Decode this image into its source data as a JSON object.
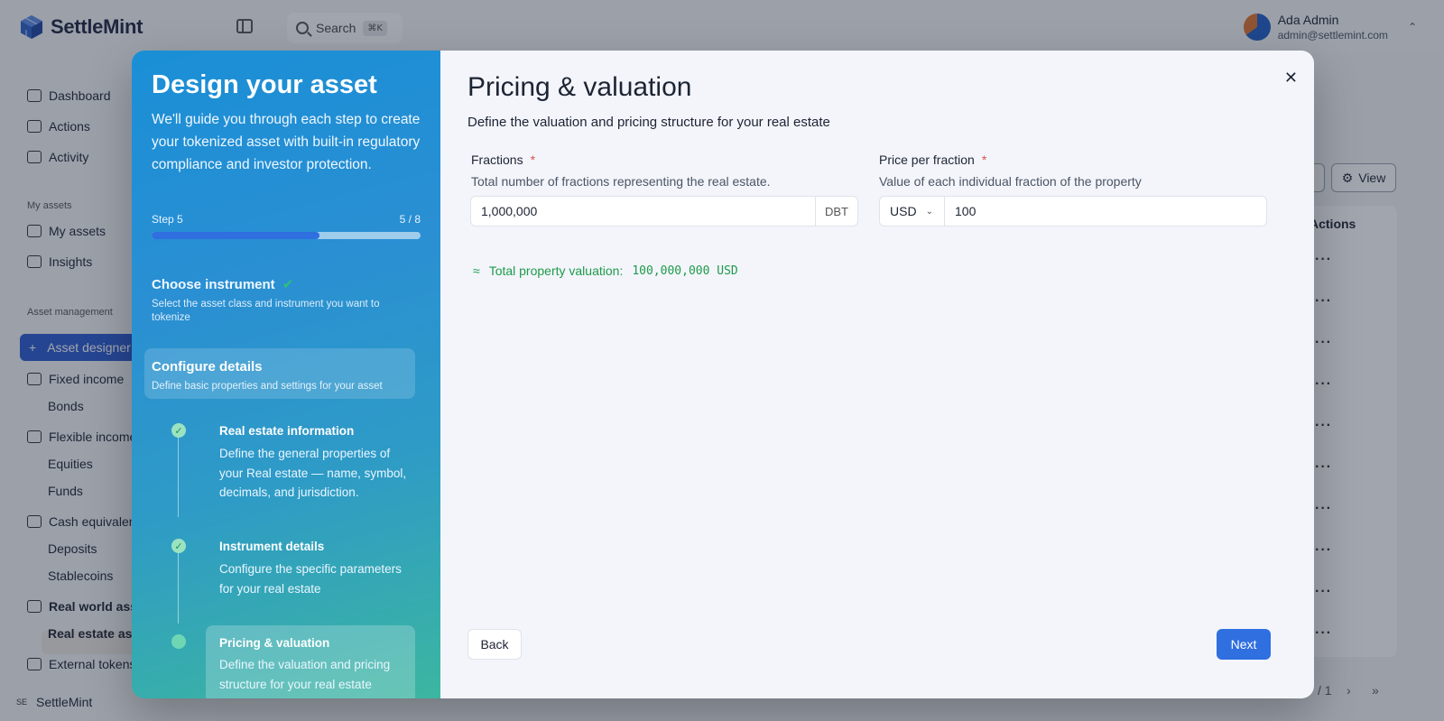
{
  "app": {
    "brand": "SettleMint",
    "search_label": "Search",
    "search_shortcut": "⌘K",
    "user_name": "Ada Admin",
    "user_email": "admin@settlemint.com"
  },
  "sidebar": {
    "items_top": [
      {
        "label": "Dashboard"
      },
      {
        "label": "Actions"
      },
      {
        "label": "Activity"
      }
    ],
    "group_my_assets": "My assets",
    "my_assets": [
      {
        "label": "My assets"
      },
      {
        "label": "Insights"
      }
    ],
    "group_asset_management": "Asset management",
    "asset_designer": "Asset designer",
    "fixed_income": "Fixed income",
    "bonds": "Bonds",
    "flexible_income": "Flexible income",
    "equities": "Equities",
    "funds": "Funds",
    "cash_equivalents": "Cash equivalents",
    "deposits": "Deposits",
    "stablecoins": "Stablecoins",
    "real_world_assets": "Real world assets",
    "real_estate_assets": "Real estate assets",
    "external_tokens": "External tokens",
    "org_badge": "SE",
    "org_name": "SettleMint"
  },
  "background_table": {
    "view_label": "View",
    "actions_header": "Actions",
    "page_info": "/ 1"
  },
  "wizard": {
    "title": "Design your asset",
    "description": "We'll guide you through each step to create your tokenized asset with built-in regulatory compliance and investor protection.",
    "step_label": "Step 5",
    "step_count": "5 / 8",
    "progress_fraction": 0.625,
    "choose_instrument": {
      "title": "Choose instrument",
      "desc": "Select the asset class and instrument you want to tokenize"
    },
    "configure_details": {
      "title": "Configure details",
      "desc": "Define basic properties and settings for your asset"
    },
    "substeps": [
      {
        "title": "Real estate information",
        "desc": "Define the general properties of your Real estate — name, symbol, decimals, and jurisdiction."
      },
      {
        "title": "Instrument details",
        "desc": "Configure the specific parameters for your real estate"
      },
      {
        "title": "Pricing & valuation",
        "desc": "Define the valuation and pricing structure for your real estate"
      }
    ]
  },
  "form": {
    "title": "Pricing & valuation",
    "subtitle": "Define the valuation and pricing structure for your real estate",
    "fractions_label": "Fractions",
    "fractions_help": "Total number of fractions representing the real estate.",
    "fractions_value": "1,000,000",
    "fractions_unit": "DBT",
    "price_label": "Price per fraction",
    "price_help": "Value of each individual fraction of the property",
    "currency": "USD",
    "price_value": "100",
    "required_mark": "*",
    "valuation_symbol": "≈",
    "valuation_label": "Total property valuation:",
    "valuation_value": "100,000,000 USD",
    "back_label": "Back",
    "next_label": "Next",
    "close_symbol": "✕"
  },
  "colors": {
    "primary": "#2f6fe0",
    "success": "#1f9a4a",
    "required": "#e05050"
  }
}
